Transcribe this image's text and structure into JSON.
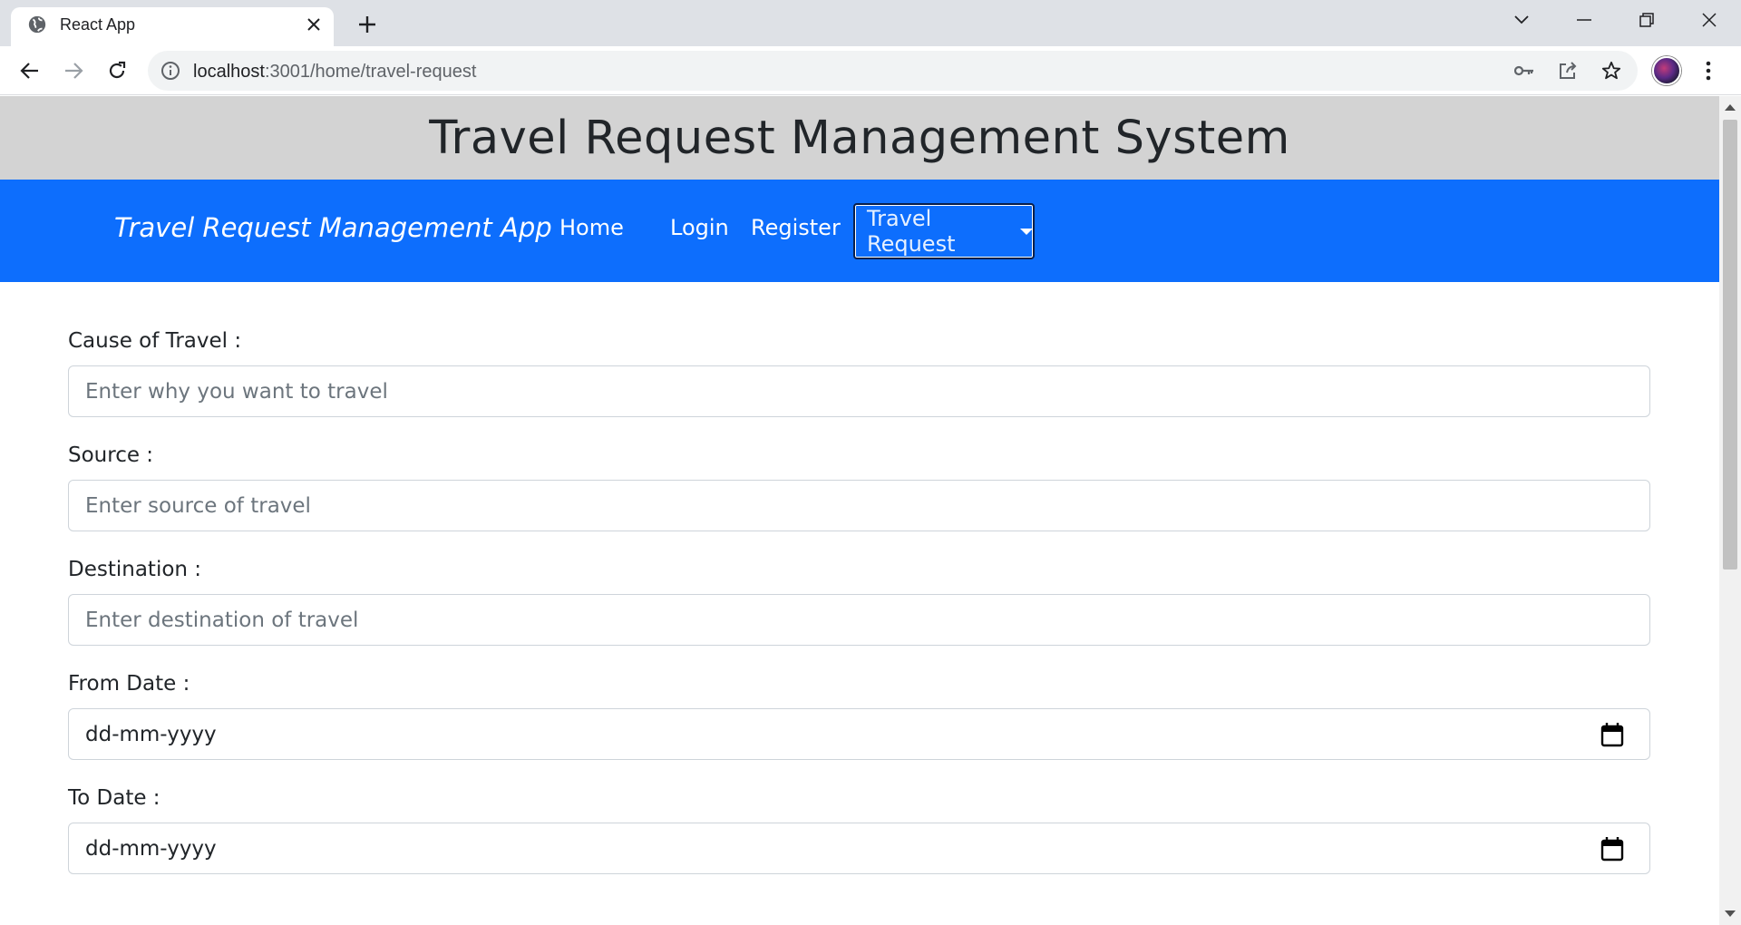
{
  "browser": {
    "tab_title": "React App",
    "url_host": "localhost",
    "url_path": ":3001/home/travel-request"
  },
  "page": {
    "header_title": "Travel Request Management System",
    "navbar": {
      "brand": "Travel Request Management App",
      "links": [
        "Home",
        "Login",
        "Register"
      ],
      "dropdown_label": "Travel Request"
    },
    "form": {
      "fields": [
        {
          "label": "Cause of Travel :",
          "placeholder": "Enter why you want to travel"
        },
        {
          "label": "Source :",
          "placeholder": "Enter source of travel"
        },
        {
          "label": "Destination :",
          "placeholder": "Enter destination of travel"
        },
        {
          "label": "From Date :",
          "value": "dd-mm-yyyy"
        },
        {
          "label": "To Date :",
          "value": "dd-mm-yyyy"
        }
      ]
    }
  },
  "colors": {
    "navbar_bg": "#0d6efd",
    "header_bg": "#d3d3d3"
  }
}
